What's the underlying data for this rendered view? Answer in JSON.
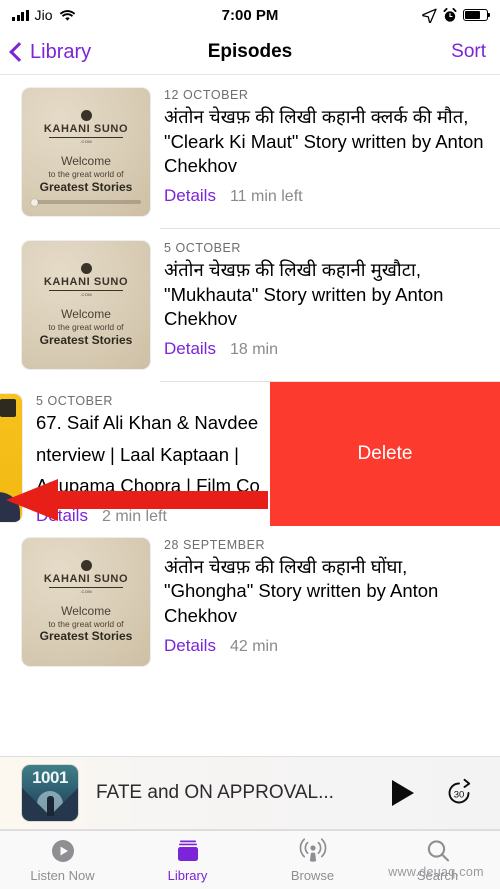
{
  "status_bar": {
    "carrier": "Jio",
    "time": "7:00 PM",
    "signal_icon": "signal-bars-icon",
    "wifi_icon": "wifi-icon",
    "location_icon": "location-arrow-icon",
    "alarm_icon": "alarm-clock-icon",
    "battery_icon": "battery-icon"
  },
  "nav": {
    "back_label": "Library",
    "title": "Episodes",
    "sort_label": "Sort",
    "accent_color": "#7B24D8"
  },
  "artwork": {
    "logo_name": "KAHANI SUNO",
    "logo_dotcom": ".COM",
    "welcome_line1": "Welcome",
    "welcome_line2": "to the great world of",
    "welcome_line3": "Greatest Stories"
  },
  "episodes": [
    {
      "date": "12 OCTOBER",
      "title": "अंतोन चेखफ़ की लिखी कहानी क्लर्क की मौत, \"Cleark Ki Maut\" Story written by Anton Chekhov",
      "details_label": "Details",
      "duration": "11 min left",
      "has_progress": true
    },
    {
      "date": "5 OCTOBER",
      "title": "अंतोन चेखफ़ की लिखी कहानी मुखौटा, \"Mukhauta\" Story written by Anton Chekhov",
      "details_label": "Details",
      "duration": "18 min",
      "has_progress": false
    },
    {
      "date": "28 SEPTEMBER",
      "title": "अंतोन चेखफ़ की लिखी कहानी घोंघा, \"Ghongha\" Story written by Anton Chekhov",
      "details_label": "Details",
      "duration": "42 min",
      "has_progress": false
    }
  ],
  "swiped_episode": {
    "date": "5 OCTOBER",
    "title_line1": "67. Saif Ali Khan & Navdee",
    "title_line2": "nterview | Laal Kaptaan |",
    "title_line3": "Anupama Chopra | Film Co",
    "details_label": "Details",
    "duration": "2 min left",
    "delete_label": "Delete",
    "delete_color": "#FC3A2D"
  },
  "mini_player": {
    "artwork_number": "1001",
    "title": "FATE and ON APPROVAL...",
    "play_icon": "play-icon",
    "skip_label": "30",
    "skip_icon": "skip-forward-30-icon"
  },
  "tab_bar": {
    "items": [
      {
        "label": "Listen Now",
        "icon": "listen-now-icon",
        "active": false
      },
      {
        "label": "Library",
        "icon": "library-icon",
        "active": true
      },
      {
        "label": "Browse",
        "icon": "browse-icon",
        "active": false
      },
      {
        "label": "Search",
        "icon": "search-icon",
        "active": false
      }
    ]
  },
  "watermark": "www.deuaq.com"
}
